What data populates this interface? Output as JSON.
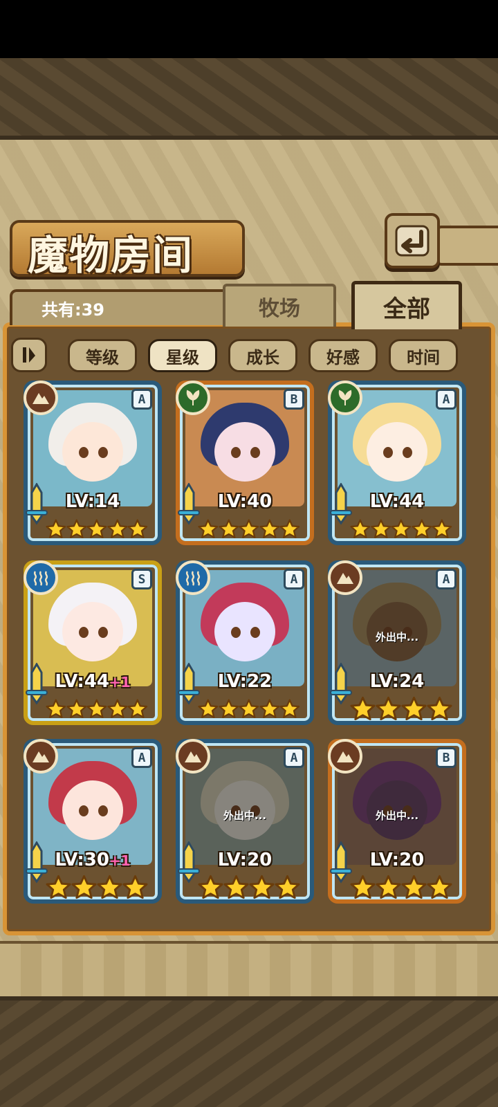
{
  "screen": {
    "title": "魔物房间",
    "total_label": "共有:39"
  },
  "tabs": [
    {
      "label": "牧场",
      "active": false
    },
    {
      "label": "全部",
      "active": true
    }
  ],
  "sort": {
    "toggle_icon": "sort-order-icon",
    "buttons": [
      {
        "label": "等级",
        "active": false
      },
      {
        "label": "星级",
        "active": true
      },
      {
        "label": "成长",
        "active": false
      },
      {
        "label": "好感",
        "active": false
      },
      {
        "label": "时间",
        "active": false
      }
    ]
  },
  "back_icon": "return-arrow-icon",
  "colors": {
    "frame_blue": "#2a5a7a",
    "frame_orange": "#c46e1e",
    "frame_gold": "#c9a016",
    "element_earth": "#6b3c22",
    "element_nature": "#2d6b2a",
    "element_water": "#1f6aa8",
    "level_plus": "#ff63b2"
  },
  "monsters": [
    {
      "rarity": "A",
      "element": "earth",
      "frame": "blue",
      "level": "LV:14",
      "plus": "",
      "stars": 5,
      "status": "",
      "palette": {
        "hair": "#f1eeea",
        "skin": "#fde7d8",
        "bg": "#7bb8c9"
      }
    },
    {
      "rarity": "B",
      "element": "nature",
      "frame": "orange",
      "level": "LV:40",
      "plus": "",
      "stars": 5,
      "status": "",
      "palette": {
        "hair": "#2e3a6e",
        "skin": "#f7dde4",
        "bg": "#c98a52"
      }
    },
    {
      "rarity": "A",
      "element": "nature",
      "frame": "blue",
      "level": "LV:44",
      "plus": "",
      "stars": 5,
      "status": "",
      "palette": {
        "hair": "#f6dc96",
        "skin": "#fdeee2",
        "bg": "#86bfcf"
      }
    },
    {
      "rarity": "S",
      "element": "water",
      "frame": "gold",
      "level": "LV:44",
      "plus": "+1",
      "stars": 5,
      "status": "",
      "palette": {
        "hair": "#f4f2f6",
        "skin": "#fde9e2",
        "bg": "#d9bd52"
      }
    },
    {
      "rarity": "A",
      "element": "water",
      "frame": "blue",
      "level": "LV:22",
      "plus": "",
      "stars": 5,
      "status": "",
      "palette": {
        "hair": "#c23a5a",
        "skin": "#e9e4ff",
        "bg": "#7ab0c4"
      }
    },
    {
      "rarity": "A",
      "element": "earth",
      "frame": "blue",
      "level": "LV:24",
      "plus": "",
      "stars": 4,
      "status": "外出中...",
      "palette": {
        "hair": "#9a8456",
        "skin": "#7a5a3a",
        "bg": "#8aa3a8"
      }
    },
    {
      "rarity": "A",
      "element": "earth",
      "frame": "blue",
      "level": "LV:30",
      "plus": "+1",
      "stars": 4,
      "status": "",
      "palette": {
        "hair": "#c23a4a",
        "skin": "#fde5dc",
        "bg": "#7fb4c6"
      }
    },
    {
      "rarity": "A",
      "element": "earth",
      "frame": "blue",
      "level": "LV:20",
      "plus": "",
      "stars": 4,
      "status": "外出中...",
      "palette": {
        "hair": "#c8c6b0",
        "skin": "#dcdcd4",
        "bg": "#8b9e94"
      }
    },
    {
      "rarity": "B",
      "element": "earth",
      "frame": "orange",
      "level": "LV:20",
      "plus": "",
      "stars": 4,
      "status": "外出中...",
      "palette": {
        "hair": "#6e3a72",
        "skin": "#5a3a5e",
        "bg": "#8d6a54"
      }
    }
  ]
}
